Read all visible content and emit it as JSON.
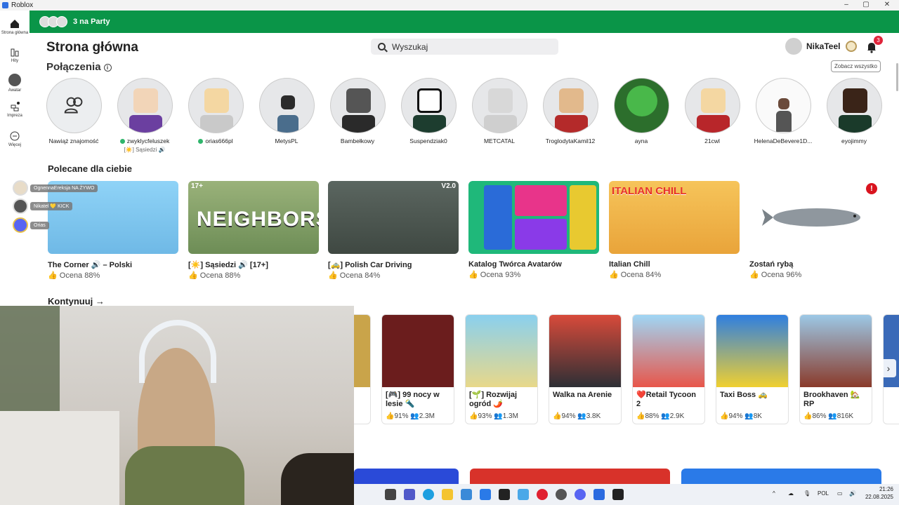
{
  "window": {
    "title": "Roblox",
    "controls": [
      "–",
      "▢",
      "✕"
    ]
  },
  "nav": [
    {
      "label": "Strona główna",
      "icon": "home-icon"
    },
    {
      "label": "Hity",
      "icon": "charts-icon"
    },
    {
      "label": "Awatar",
      "icon": "avatar-icon"
    },
    {
      "label": "Impreza",
      "icon": "party-icon"
    },
    {
      "label": "Więcej",
      "icon": "more-icon"
    }
  ],
  "party_bar": {
    "label": "3 na Party"
  },
  "header": {
    "title": "Strona główna",
    "search_placeholder": "Wyszukaj",
    "username": "NikaTeel",
    "notifications": "3"
  },
  "connections": {
    "title": "Połączenia",
    "see_all": "Zobacz wszystko",
    "items": [
      {
        "name": "Nawiąż znajomość",
        "online": false,
        "status": ""
      },
      {
        "name": "zwyklycfeluszek",
        "online": true,
        "status": "[☀️] Sąsiedzi 🔊"
      },
      {
        "name": "orias666pl",
        "online": true,
        "status": ""
      },
      {
        "name": "MetysPL",
        "online": false,
        "status": ""
      },
      {
        "name": "Bambełkowy",
        "online": false,
        "status": ""
      },
      {
        "name": "Suspendziak0",
        "online": false,
        "status": ""
      },
      {
        "name": "METCATAL",
        "online": false,
        "status": ""
      },
      {
        "name": "TroglodytaKamil12",
        "online": false,
        "status": ""
      },
      {
        "name": "ayna",
        "online": false,
        "status": ""
      },
      {
        "name": "21cwl",
        "online": false,
        "status": ""
      },
      {
        "name": "HelenaDeBevere1D...",
        "online": false,
        "status": ""
      },
      {
        "name": "eyojimmy",
        "online": false,
        "status": ""
      }
    ]
  },
  "recommended": {
    "title": "Polecane dla ciebie",
    "items": [
      {
        "title": "The Corner 🔊 – Polski",
        "rating": "Ocena 88%",
        "color": "#7ec6f0"
      },
      {
        "title": "[☀️] Sąsiedzi 🔊 [17+]",
        "rating": "Ocena 88%",
        "color": "#8aa56a",
        "tag": "17+"
      },
      {
        "title": "[🚕] Polish Car Driving",
        "rating": "Ocena 84%",
        "color": "#4f5a52",
        "tag": "V2.0"
      },
      {
        "title": "Katalog Twórca Avatarów",
        "rating": "Ocena 93%",
        "color": "#1fb87a"
      },
      {
        "title": "Italian Chill",
        "rating": "Ocena 84%",
        "color": "#f1b64a"
      },
      {
        "title": "Zostań rybą",
        "rating": "Ocena 96%",
        "color": "#ffffff"
      }
    ]
  },
  "party_members": [
    {
      "name": "OgnennaEreksja",
      "extra": "NA ŻYWO"
    },
    {
      "name": "Nikatel",
      "extra": "💛 KICK"
    },
    {
      "name": "Orias",
      "extra": ""
    }
  ],
  "continue": {
    "title": "Kontynuuj →",
    "items": [
      {
        "title": "[🎮] 99 nocy w lesie 🔦",
        "rating": "91%",
        "players": "2.3M",
        "color": "#6b1d1d"
      },
      {
        "title": "[🌱] Rozwijaj ogród 🌶️",
        "rating": "93%",
        "players": "1.3M",
        "color": "#7ec8e8"
      },
      {
        "title": "Walka na Arenie",
        "rating": "94%",
        "players": "3.8K",
        "color": "#2d2f35"
      },
      {
        "title": "❤️Retail Tycoon 2",
        "rating": "88%",
        "players": "2.9K",
        "color": "#e8564a"
      },
      {
        "title": "Taxi Boss 🚕",
        "rating": "94%",
        "players": "8K",
        "color": "#2f7fe0"
      },
      {
        "title": "Brookhaven 🏡RP",
        "rating": "86%",
        "players": "816K",
        "color": "#7ab4d8"
      }
    ]
  },
  "taskbar": {
    "lang": "POL",
    "time": "21:26",
    "date": "22.08.2025"
  }
}
